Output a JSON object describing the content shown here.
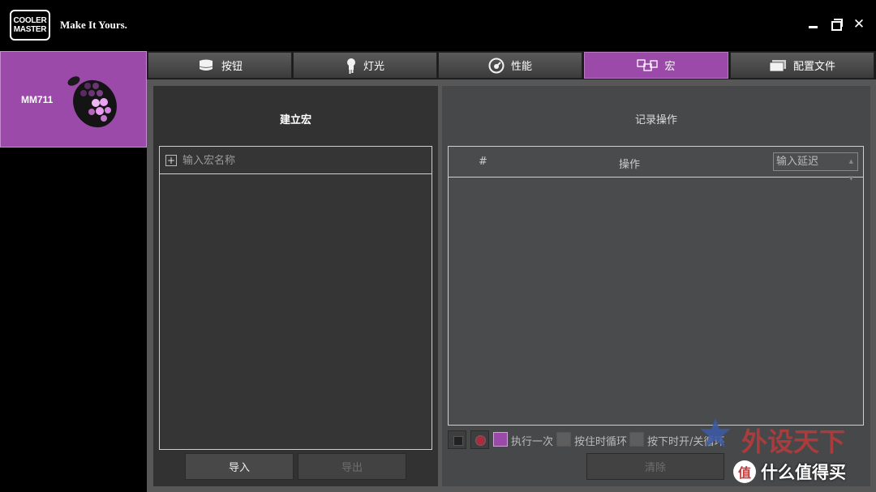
{
  "app": {
    "logo_lines": [
      "COOLER",
      "MASTER"
    ],
    "slogan": "Make It Yours.",
    "accent_color": "#9b4aaa"
  },
  "window_controls": [
    "minimize-icon",
    "maximize-icon",
    "close-icon"
  ],
  "device": {
    "name": "MM711"
  },
  "tabs": [
    {
      "label": "按钮",
      "icon": "mouse-button-icon",
      "active": false
    },
    {
      "label": "灯光",
      "icon": "bulb-icon",
      "active": false
    },
    {
      "label": "性能",
      "icon": "gauge-icon",
      "active": false
    },
    {
      "label": "宏",
      "icon": "macro-icon",
      "active": true
    },
    {
      "label": "配置文件",
      "icon": "profile-icon",
      "active": false
    }
  ],
  "macro_panel": {
    "title": "建立宏",
    "name_placeholder": "输入宏名称",
    "import_label": "导入",
    "export_label": "导出"
  },
  "record_panel": {
    "title": "记录操作",
    "col_number": "#",
    "col_action": "操作",
    "delay_placeholder": "输入延迟",
    "options": {
      "run_once": "执行一次",
      "loop_while_held": "按住时循环",
      "toggle_on_press": "按下时开/关循环"
    },
    "clear_label": "清除"
  },
  "watermark": {
    "brand": "外设天下",
    "badge_glyph": "值",
    "badge_text": "什么值得买"
  }
}
